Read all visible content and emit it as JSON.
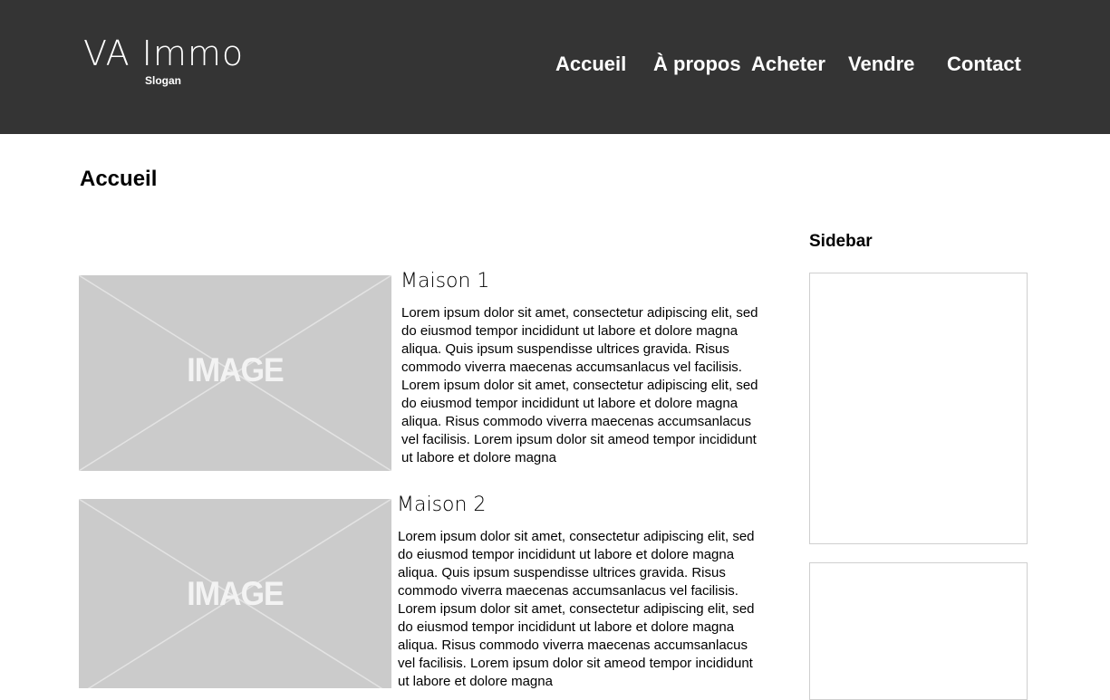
{
  "header": {
    "logo_title": "VA Immo",
    "slogan": "Slogan",
    "nav": [
      {
        "label": "Accueil"
      },
      {
        "label": "À propos"
      },
      {
        "label": "Acheter"
      },
      {
        "label": "Vendre"
      },
      {
        "label": "Contact"
      }
    ],
    "background_color": "#343434"
  },
  "main": {
    "page_title": "Accueil",
    "cards": [
      {
        "image_label": "IMAGE",
        "title": "Maison 1",
        "text": "Lorem ipsum dolor sit amet, consectetur adipiscing elit, sed do eiusmod tempor incididunt ut labore et dolore magna aliqua. Quis ipsum suspendisse ultrices gravida. Risus commodo viverra maecenas accumsanlacus vel facilisis. Lorem ipsum dolor sit amet, consectetur adipiscing elit, sed do eiusmod tempor incididunt ut labore et dolore magna aliqua. Risus commodo viverra maecenas accumsanlacus vel facilisis. Lorem ipsum dolor sit ameod tempor incididunt ut labore et dolore magna"
      },
      {
        "image_label": "IMAGE",
        "title": "Maison 2",
        "text": "Lorem ipsum dolor sit amet, consectetur adipiscing elit, sed do eiusmod tempor incididunt ut labore et dolore magna aliqua. Quis ipsum suspendisse ultrices gravida. Risus commodo viverra maecenas accumsanlacus vel facilisis. Lorem ipsum dolor sit amet, consectetur adipiscing elit, sed do eiusmod tempor incididunt ut labore et dolore magna aliqua. Risus commodo viverra maecenas accumsanlacus vel facilisis. Lorem ipsum dolor sit ameod tempor incididunt ut labore et dolore magna"
      }
    ]
  },
  "sidebar": {
    "title": "Sidebar"
  }
}
